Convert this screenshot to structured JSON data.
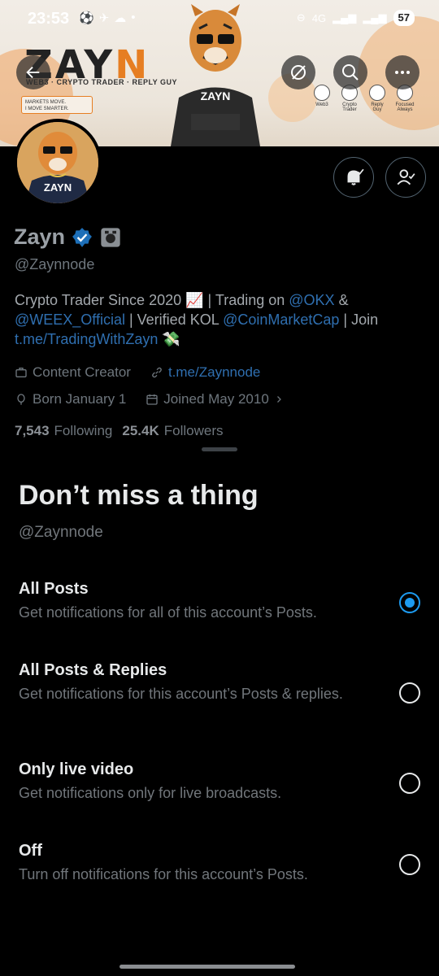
{
  "status_bar": {
    "time": "23:53",
    "network": "4G",
    "battery": "57"
  },
  "banner": {
    "brand_main": "ZAY",
    "brand_accent": "N",
    "brand_subtitle": "WEB3 · CRYPTO TRADER · REPLY GUY",
    "markets_line1": "MARKETS MOVE.",
    "markets_line2": "I MOVE SMARTER.",
    "hoodie_text": "ZAYN",
    "icons": [
      {
        "label": "Web3",
        "icon": "globe-icon"
      },
      {
        "label": "Crypto Trader",
        "icon": "chart-icon"
      },
      {
        "label": "Reply Guy",
        "icon": "chat-icon"
      },
      {
        "label": "Focused Always",
        "icon": "target-icon"
      }
    ]
  },
  "profile": {
    "name": "Zayn",
    "handle": "@Zaynnode",
    "avatar_text": "ZAYN",
    "bio_parts": {
      "p1": "Crypto Trader Since 2020 📈 | Trading on ",
      "l1": "@OKX",
      "p2": " & ",
      "l2": "@WEEX_Official",
      "p3": " | Verified KOL ",
      "l3": "@CoinMarketCap",
      "p4": " | Join ",
      "l4": "t.me/TradingWithZayn",
      "p5": " 💸"
    },
    "category": "Content Creator",
    "website": "t.me/Zaynnode",
    "birthday": "Born January 1",
    "joined": "Joined May 2010",
    "following_count": "7,543",
    "following_label": "Following",
    "followers_count": "25.4K",
    "followers_label": "Followers"
  },
  "sheet": {
    "title": "Don’t miss a thing",
    "handle": "@Zaynnode",
    "options": [
      {
        "title": "All Posts",
        "desc": "Get notifications for all of this account’s Posts.",
        "selected": true
      },
      {
        "title": "All Posts & Replies",
        "desc": "Get notifications for this account’s Posts & replies.",
        "selected": false
      },
      {
        "title": "Only live video",
        "desc": "Get notifications only for live broadcasts.",
        "selected": false
      },
      {
        "title": "Off",
        "desc": "Turn off notifications for this account’s Posts.",
        "selected": false
      }
    ]
  },
  "colors": {
    "accent_blue": "#1d9bf0",
    "link_blue": "#2f6fb0",
    "brand_orange": "#e67e22"
  }
}
